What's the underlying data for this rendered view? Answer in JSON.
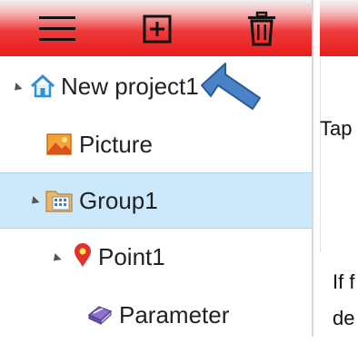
{
  "toolbar": {
    "icons": [
      "menu-icon",
      "add-square-icon",
      "trash-icon"
    ]
  },
  "tree": {
    "items": [
      {
        "label": "New project1",
        "icon": "home-icon",
        "expanded": true
      },
      {
        "label": "Picture",
        "icon": "picture-icon"
      },
      {
        "label": "Group1",
        "icon": "group-folder-icon",
        "expanded": true,
        "selected": true
      },
      {
        "label": "Point1",
        "icon": "location-pin-icon",
        "expanded": true
      },
      {
        "label": "Parameter",
        "icon": "parameter-icon"
      }
    ]
  },
  "side_panel": {
    "texts": [
      "Tap",
      "If f",
      "de"
    ]
  },
  "colors": {
    "toolbar_red": "#e81c1c",
    "selection_blue": "#cce8fb",
    "arrow_blue": "#4a82c8",
    "home_icon": "#2f8fd8",
    "pin_red": "#e03030"
  }
}
